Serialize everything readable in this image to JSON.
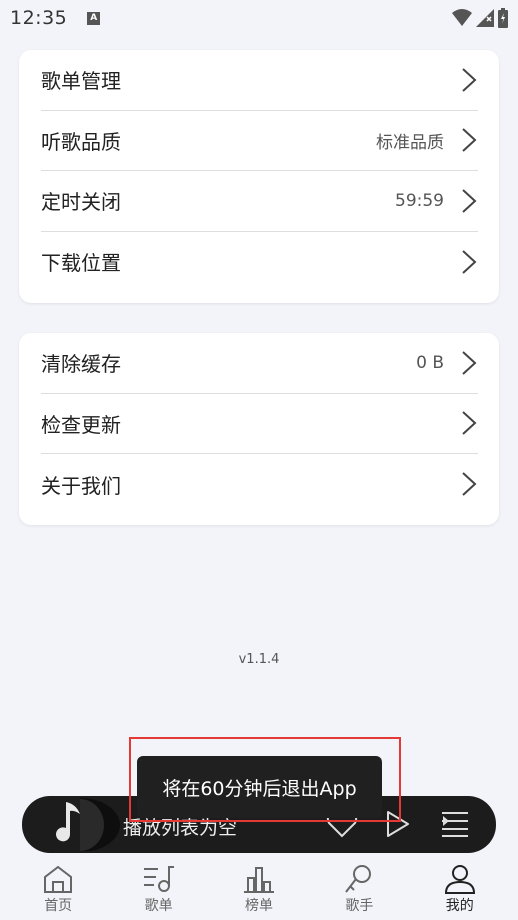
{
  "status_bar": {
    "time": "12:35",
    "a_icon": "A"
  },
  "settings_group1": [
    {
      "label": "歌单管理",
      "value": ""
    },
    {
      "label": "听歌品质",
      "value": "标准品质"
    },
    {
      "label": "定时关闭",
      "value": "59:59"
    },
    {
      "label": "下载位置",
      "value": ""
    }
  ],
  "settings_group2": [
    {
      "label": "清除缓存",
      "value": "0 B"
    },
    {
      "label": "检查更新",
      "value": ""
    },
    {
      "label": "关于我们",
      "value": ""
    }
  ],
  "version": "v1.1.4",
  "player": {
    "status_text": "播放列表为空"
  },
  "toast": {
    "text": "将在60分钟后退出App"
  },
  "nav": [
    {
      "label": "首页",
      "icon": "home-icon",
      "active": false
    },
    {
      "label": "歌单",
      "icon": "playlist-icon",
      "active": false
    },
    {
      "label": "榜单",
      "icon": "chart-icon",
      "active": false
    },
    {
      "label": "歌手",
      "icon": "microphone-icon",
      "active": false
    },
    {
      "label": "我的",
      "icon": "user-icon",
      "active": true
    }
  ],
  "colors": {
    "background": "#f3f4f9",
    "card": "#ffffff",
    "player": "#1c1c1c",
    "highlight": "#e53935"
  }
}
